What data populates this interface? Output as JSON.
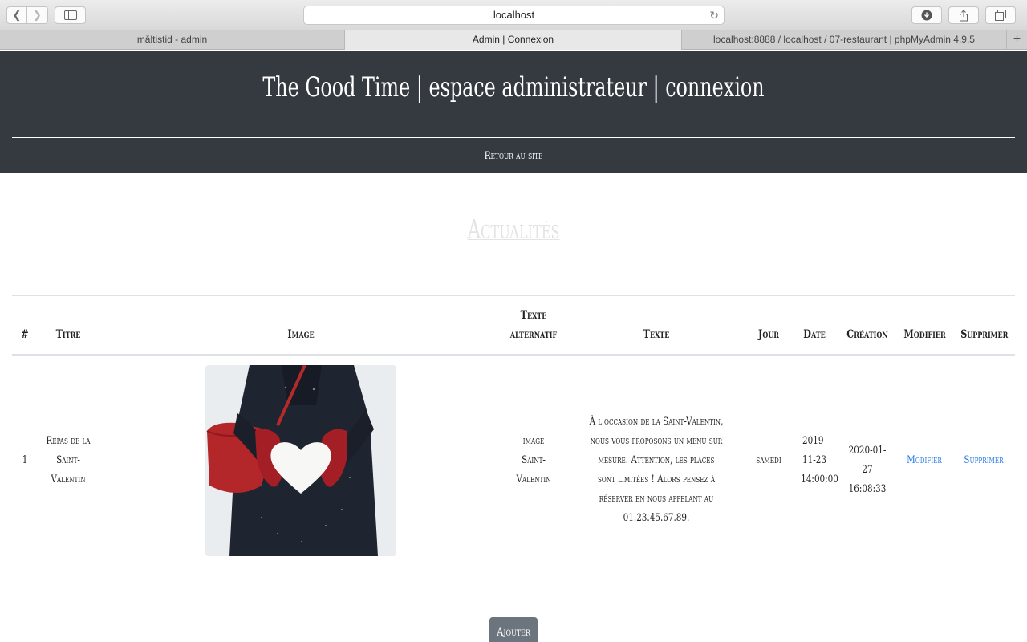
{
  "browser": {
    "url": "localhost",
    "tabs": [
      {
        "label": "måltistid - admin"
      },
      {
        "label": "Admin | Connexion"
      },
      {
        "label": "localhost:8888 / localhost / 07-restaurant | phpMyAdmin 4.9.5"
      }
    ],
    "new_tab_symbol": "+",
    "icons": {
      "back": "chevron-left-icon",
      "forward": "chevron-right-icon",
      "sidebar": "sidebar-icon",
      "reload": "reload-icon",
      "download": "download-icon",
      "share": "share-icon",
      "tabs": "tabs-overview-icon"
    }
  },
  "header": {
    "title": "The Good Time | espace administrateur | connexion",
    "back_link": "Retour au site"
  },
  "page": {
    "title": "Actualités"
  },
  "table": {
    "columns": [
      "#",
      "Titre",
      "Image",
      "Texte alternatif",
      "Texte",
      "Jour",
      "Date",
      "Création",
      "Modifier",
      "Supprimer"
    ],
    "rows": [
      {
        "id": "1",
        "titre": "Repas de la Saint-Valentin",
        "alt": "image Saint-Valentin",
        "texte": "À l'occasion de la Saint-Valentin, nous vous proposons un menu sur mesure. Attention, les places sont limitées ! Alors pensez à réserver en nous appelant au 01.23.45.67.89.",
        "jour": "samedi",
        "date": "2019-11-23 14:00:00",
        "creation": "2020-01-27 16:08:33",
        "modifier": "Modifier",
        "supprimer": "Supprimer"
      }
    ]
  },
  "add_button": "Ajouter",
  "colors": {
    "header_bg": "#343a40",
    "link": "#2b7de9",
    "button_bg": "#6c757d"
  }
}
